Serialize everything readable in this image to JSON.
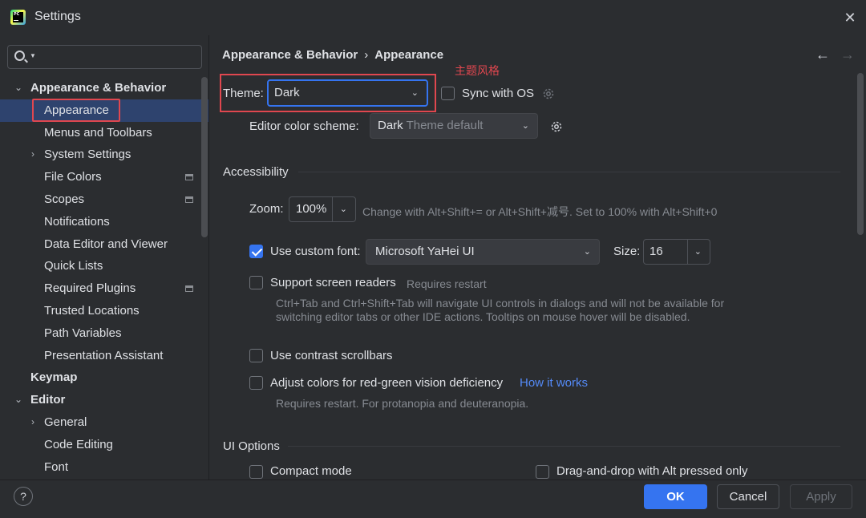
{
  "window": {
    "title": "Settings",
    "app_icon_text": "PC"
  },
  "sidebar": {
    "search": {
      "value": ""
    },
    "items": [
      {
        "label": "Appearance & Behavior",
        "expanded": true
      },
      {
        "label": "Appearance"
      },
      {
        "label": "Menus and Toolbars"
      },
      {
        "label": "System Settings"
      },
      {
        "label": "File Colors"
      },
      {
        "label": "Scopes"
      },
      {
        "label": "Notifications"
      },
      {
        "label": "Data Editor and Viewer"
      },
      {
        "label": "Quick Lists"
      },
      {
        "label": "Required Plugins"
      },
      {
        "label": "Trusted Locations"
      },
      {
        "label": "Path Variables"
      },
      {
        "label": "Presentation Assistant"
      },
      {
        "label": "Keymap"
      },
      {
        "label": "Editor",
        "expanded": true
      },
      {
        "label": "General"
      },
      {
        "label": "Code Editing"
      },
      {
        "label": "Font"
      }
    ]
  },
  "breadcrumb": {
    "parent": "Appearance & Behavior",
    "separator": "›",
    "current": "Appearance"
  },
  "annotation": "主题风格",
  "theme": {
    "label": "Theme:",
    "value": "Dark"
  },
  "sync_os": {
    "label": "Sync with OS",
    "checked": false
  },
  "editor_scheme": {
    "label": "Editor color scheme:",
    "value_main": "Dark",
    "value_dim": "Theme default"
  },
  "accessibility": {
    "title": "Accessibility",
    "zoom_label": "Zoom:",
    "zoom_value": "100%",
    "zoom_hint": "Change with Alt+Shift+= or Alt+Shift+减号. Set to 100% with Alt+Shift+0",
    "custom_font_label": "Use custom font:",
    "custom_font_checked": true,
    "font_value": "Microsoft YaHei UI",
    "size_label": "Size:",
    "size_value": "16",
    "screen_readers_label": "Support screen readers",
    "screen_readers_hint": "Requires restart",
    "screen_readers_desc": "Ctrl+Tab and Ctrl+Shift+Tab will navigate UI controls in dialogs and will not be available for switching editor tabs or other IDE actions. Tooltips on mouse hover will be disabled.",
    "contrast_label": "Use contrast scrollbars",
    "redgreen_label": "Adjust colors for red-green vision deficiency",
    "redgreen_link": "How it works",
    "redgreen_desc": "Requires restart. For protanopia and deuteranopia."
  },
  "ui_options": {
    "title": "UI Options",
    "compact_label": "Compact mode",
    "dnd_label": "Drag-and-drop with Alt pressed only"
  },
  "footer": {
    "help": "?",
    "ok": "OK",
    "cancel": "Cancel",
    "apply": "Apply"
  },
  "colors": {
    "accent": "#3574f0",
    "annotation": "#e0474f",
    "link": "#548af7",
    "selection": "#2e436e"
  }
}
